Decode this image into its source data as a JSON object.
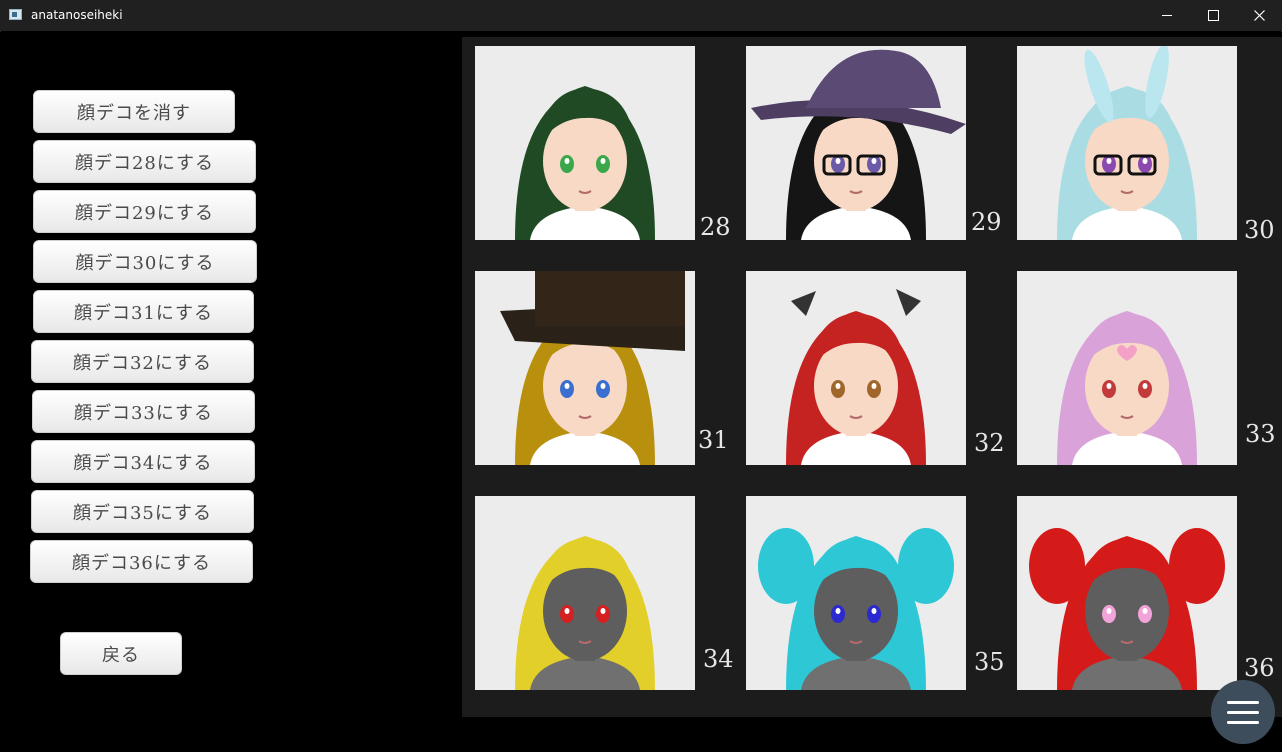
{
  "window": {
    "title": "anatanoseiheki"
  },
  "left_panel": {
    "buttons": [
      {
        "label": "顔デコを消す"
      },
      {
        "label": "顔デコ28にする"
      },
      {
        "label": "顔デコ29にする"
      },
      {
        "label": "顔デコ30にする"
      },
      {
        "label": "顔デコ31にする"
      },
      {
        "label": "顔デコ32にする"
      },
      {
        "label": "顔デコ33にする"
      },
      {
        "label": "顔デコ34にする"
      },
      {
        "label": "顔デコ35にする"
      },
      {
        "label": "顔デコ36にする"
      }
    ],
    "back_label": "戻る"
  },
  "gallery": {
    "items": [
      {
        "number": "28",
        "hair": "#1f4a24",
        "skin": "#f7d9c6",
        "eyes": "#3aa84a",
        "accessory": "none"
      },
      {
        "number": "29",
        "hair": "#151515",
        "skin": "#f7d9c6",
        "eyes": "#6b5aa8",
        "accessory": "witch-hat-glasses"
      },
      {
        "number": "30",
        "hair": "#a9dde3",
        "skin": "#f7d9c6",
        "eyes": "#8a4ab0",
        "accessory": "bunny-ears-glasses"
      },
      {
        "number": "31",
        "hair": "#b8900e",
        "skin": "#f7d9c6",
        "eyes": "#3a6fd0",
        "accessory": "top-hat"
      },
      {
        "number": "32",
        "hair": "#c52222",
        "skin": "#f7d9c6",
        "eyes": "#a0662a",
        "accessory": "bat-wings"
      },
      {
        "number": "33",
        "hair": "#d9a3d9",
        "skin": "#f7d9c6",
        "eyes": "#c23a3a",
        "accessory": "forehead-heart"
      },
      {
        "number": "34",
        "hair": "#e2cf2a",
        "skin": "#5e5e5e",
        "eyes": "#d42020",
        "accessory": "none"
      },
      {
        "number": "35",
        "hair": "#2ec7d6",
        "skin": "#5e5e5e",
        "eyes": "#2a2ad0",
        "accessory": "twin-tails"
      },
      {
        "number": "36",
        "hair": "#d51a1a",
        "skin": "#5e5e5e",
        "eyes": "#f2a3d9",
        "accessory": "twin-tails"
      }
    ]
  }
}
